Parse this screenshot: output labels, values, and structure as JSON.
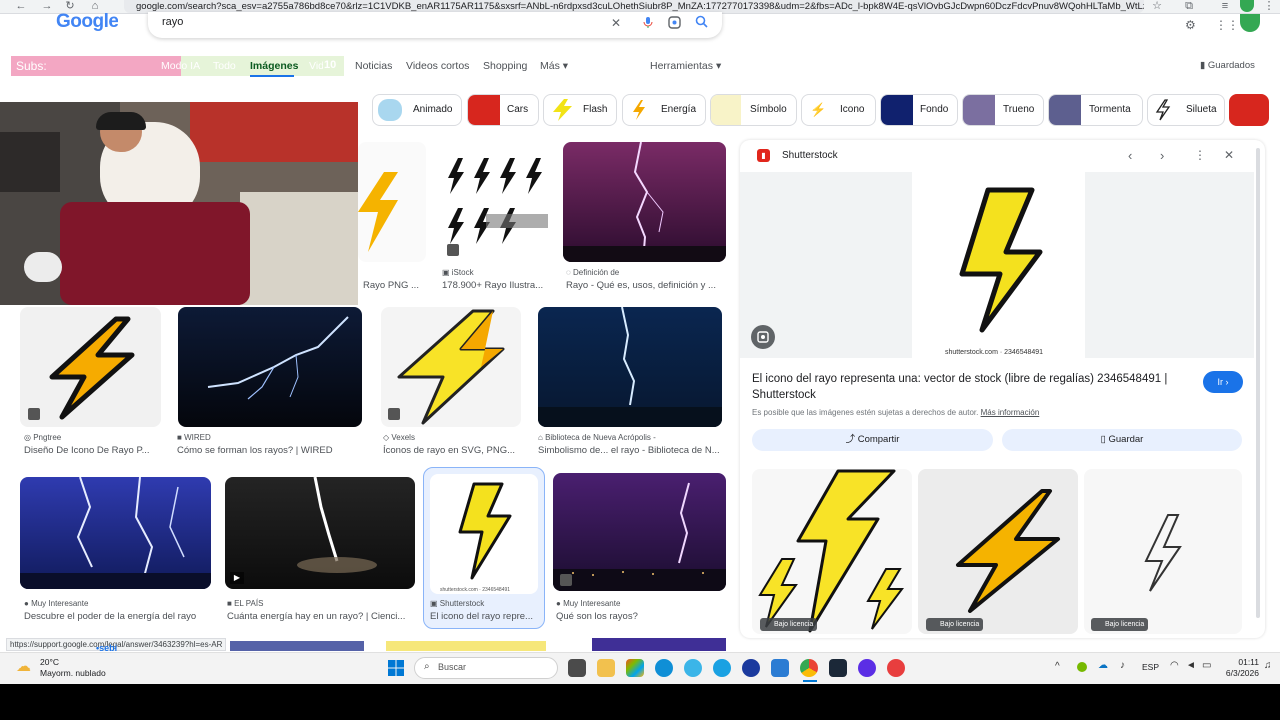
{
  "browser": {
    "url": "google.com/search?sca_esv=a2755a786bd8ce70&rlz=1C1VDKB_enAR1175AR1175&sxsrf=ANbL-n6rdpxsd3cuLOhethSiubr8P_MnZA:1772770173398&udm=2&fbs=ADc_l-bpk8W4E-qsVlOvbGJcDwpn60DczFdcvPnuv8WQohHLTaMb_WtLz0aQ41..."
  },
  "google": {
    "logo": "Google",
    "query": "rayo",
    "tabs": [
      "Modo IA",
      "Todo",
      "Imágenes",
      "Videos",
      "Noticias",
      "Videos cortos",
      "Shopping",
      "Más"
    ],
    "tools": "Herramientas",
    "saved": "Guardados"
  },
  "overlay": {
    "subs_label": "Subs:",
    "subs_count": "10",
    "status_url": "https://support.google.com/legal/answer/3463239?hl=es-AR",
    "stream_handle": "•sebi"
  },
  "chips": [
    "Animado",
    "Cars",
    "Flash",
    "Energía",
    "Símbolo",
    "Icono",
    "Fondo",
    "Trueno",
    "Tormenta",
    "Silueta"
  ],
  "results": {
    "row1": [
      {
        "src": "",
        "title": "Rayo PNG ..."
      },
      {
        "src": "iStock",
        "title": "178.900+ Rayo Ilustra..."
      },
      {
        "src": "Definición de",
        "title": "Rayo - Qué es, usos, definición y ..."
      }
    ],
    "row2": [
      {
        "src": "Pngtree",
        "title": "Diseño De Icono De Rayo P..."
      },
      {
        "src": "WIRED",
        "title": "Cómo se forman los rayos? | WIRED"
      },
      {
        "src": "Vexels",
        "title": "Íconos de rayo en SVG, PNG..."
      },
      {
        "src": "Biblioteca de Nueva Acrópolis -",
        "title": "Simbolismo de... el rayo - Biblioteca de N..."
      }
    ],
    "row3": [
      {
        "src": "Muy Interesante",
        "title": "Descubre el poder de la energía del rayo"
      },
      {
        "src": "EL PAÍS",
        "title": "Cuánta energía hay en un rayo? | Cienci..."
      },
      {
        "src": "Shutterstock",
        "title": "El icono del rayo repre..."
      },
      {
        "src": "Muy Interesante",
        "title": "Qué son los rayos?"
      }
    ],
    "watermark": "shutterstock.com · 2346548491"
  },
  "panel": {
    "source": "Shutterstock",
    "watermark": "shutterstock.com · 2346548491",
    "title": "El icono del rayo representa una: vector de stock (libre de regalías) 2346548491 | Shutterstock",
    "go": "Ir",
    "rights": "Es posible que las imágenes estén sujetas a derechos de autor.",
    "more_info": "Más información",
    "share": "Compartir",
    "save": "Guardar",
    "license_badge": "Bajo licencia"
  },
  "taskbar": {
    "weather_temp": "20°C",
    "weather_desc": "Mayorm. nublado",
    "search": "Buscar",
    "lang": "ESP",
    "time": "01:11",
    "date": "6/3/2026"
  },
  "colors": {
    "accent": "#1a73e8",
    "bolt": "#f4e11e",
    "bolt_orange": "#f5a800"
  }
}
